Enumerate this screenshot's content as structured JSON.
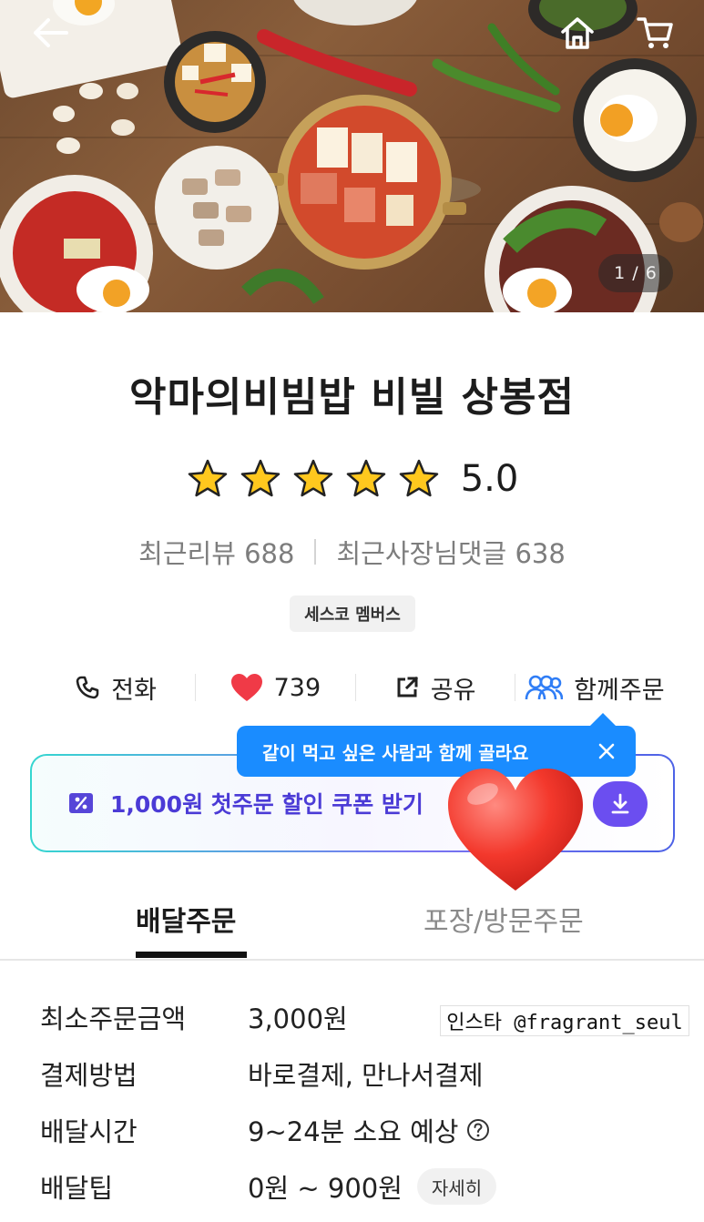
{
  "hero": {
    "counter": "1 / 6",
    "icons": {
      "back": "back-arrow-icon",
      "home": "home-icon",
      "cart": "cart-icon"
    }
  },
  "store": {
    "name": "악마의비빔밥 비빌 상봉점",
    "rating": "5.0",
    "stars": 5,
    "recent_reviews": "최근리뷰 688",
    "owner_replies": "최근사장님댓글 638",
    "badge": "세스코 멤버스"
  },
  "actions": {
    "call": "전화",
    "likes": "739",
    "share": "공유",
    "group_order": "함께주문"
  },
  "tooltip": {
    "text": "같이 먹고 싶은 사람과 함께 골라요"
  },
  "coupon": {
    "text": "1,000원 첫주문 할인 쿠폰 받기"
  },
  "tabs": {
    "delivery": "배달주문",
    "pickup": "포장/방문주문"
  },
  "info": [
    {
      "label": "최소주문금액",
      "value": "3,000원"
    },
    {
      "label": "결제방법",
      "value": "바로결제, 만나서결제"
    },
    {
      "label": "배달시간",
      "value": "9~24분 소요 예상"
    },
    {
      "label": "배달팁",
      "value": "0원 ~ 900원",
      "button": "자세히"
    }
  ],
  "watermark": "인스타 @fragrant_seul",
  "colors": {
    "accent_blue": "#1a8cff",
    "coupon_purple": "#4b3bd6",
    "like_red": "#f03a47",
    "star_yellow": "#ffc81e"
  }
}
